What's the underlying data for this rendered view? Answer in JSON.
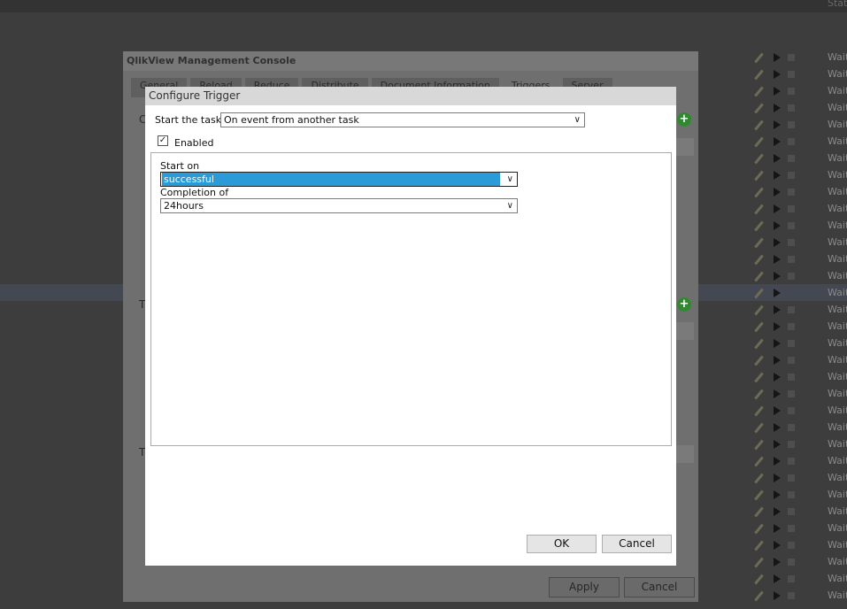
{
  "background": {
    "status_header": "Stat",
    "task_rows": [
      "Wait",
      "Wait",
      "Wait",
      "Wait",
      "Wait",
      "Wait",
      "Wait",
      "Wait",
      "Wait",
      "Wait",
      "Wait",
      "Wait",
      "Wait",
      "Wait",
      "Wait",
      "Wait",
      "Wait",
      "Wait",
      "Wait",
      "Wait",
      "Wait",
      "Wait",
      "Wait",
      "Wait",
      "Wait",
      "Wait",
      "Wait",
      "Wait",
      "Wait",
      "Wait",
      "Wait",
      "Wait",
      "Wait"
    ],
    "highlighted_row": 14
  },
  "console": {
    "title": "QlikView Management Console",
    "tabs": [
      "General",
      "Reload",
      "Reduce",
      "Distribute",
      "Document Information",
      "Triggers",
      "Server"
    ],
    "active_tab": "Triggers",
    "section_labels": [
      "C",
      "T",
      "T"
    ],
    "apply_label": "Apply",
    "cancel_label": "Cancel"
  },
  "dialog": {
    "title": "Configure Trigger",
    "start_task_label": "Start the task",
    "start_task_value": "On event from another task",
    "enabled_label": "Enabled",
    "enabled_checked": true,
    "start_on_label": "Start on",
    "start_on_value": "successful",
    "completion_label": "Completion of",
    "completion_value": "24hours",
    "ok_label": "OK",
    "cancel_label": "Cancel"
  },
  "colors": {
    "selection": "#2a9ad8",
    "add_icon": "#2f8a2f"
  }
}
